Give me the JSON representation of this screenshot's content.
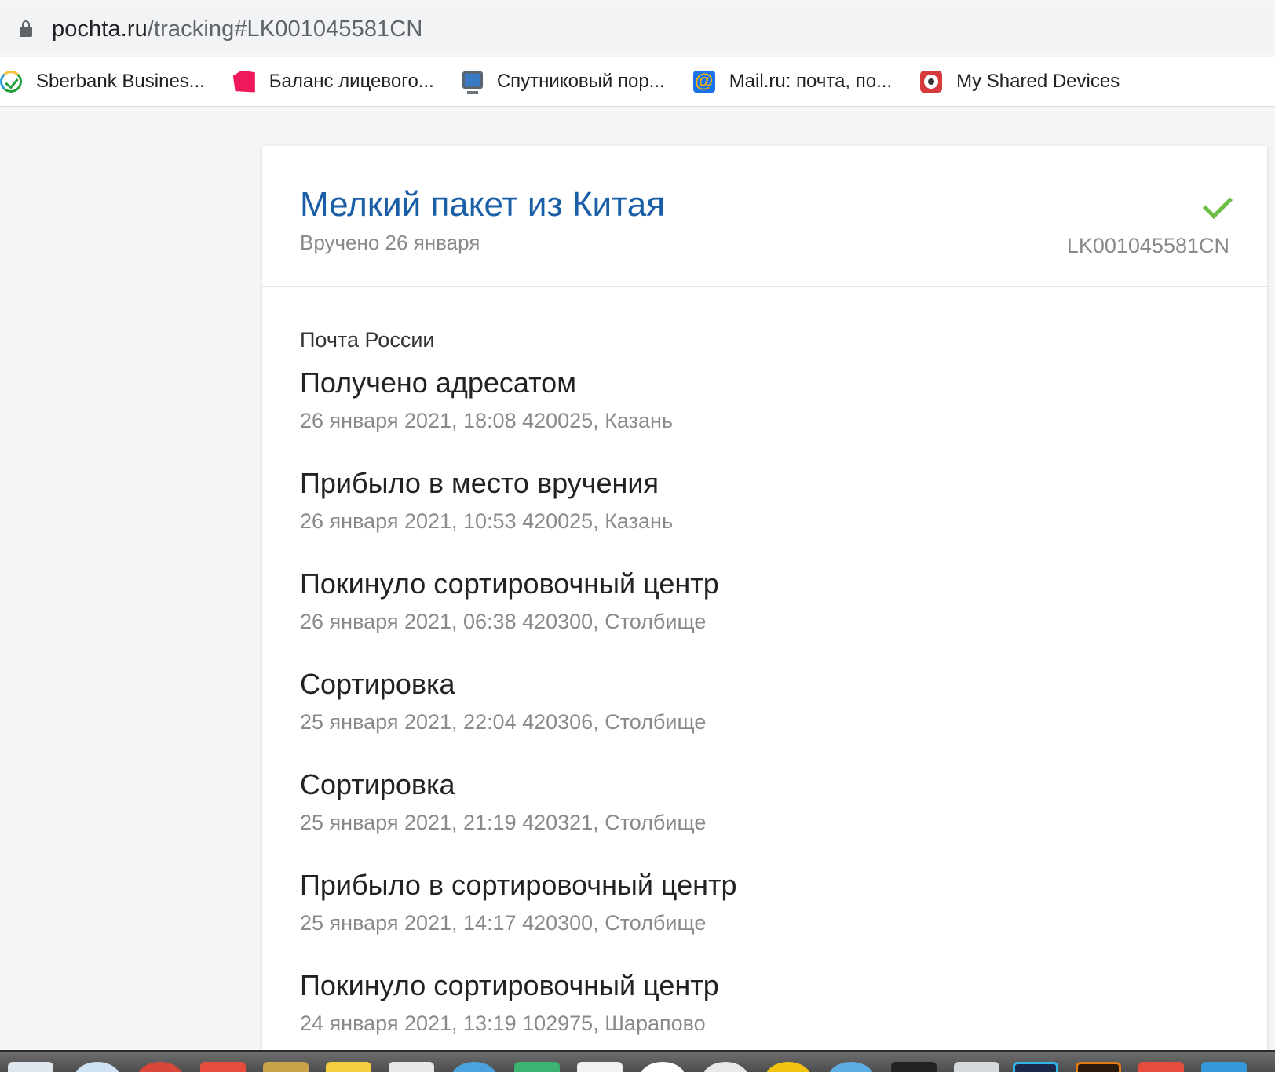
{
  "browser": {
    "url_domain": "pochta.ru",
    "url_path": "/tracking#LK001045581CN",
    "bookmarks": [
      {
        "label": "Sberbank Busines...",
        "icon": "sberbank-icon"
      },
      {
        "label": "Баланс лицевого...",
        "icon": "pink-shape-icon"
      },
      {
        "label": "Спутниковый пор...",
        "icon": "monitor-icon"
      },
      {
        "label": "Mail.ru: почта, по...",
        "icon": "mail-at-icon"
      },
      {
        "label": "My Shared Devices",
        "icon": "devices-icon"
      }
    ]
  },
  "parcel": {
    "title": "Мелкий пакет из Китая",
    "subtitle": "Вручено 26 января",
    "tracking_number": "LK001045581CN",
    "status_icon": "check-icon",
    "accent_color": "#1a5ea8",
    "check_color": "#6cbe45"
  },
  "history": {
    "carrier": "Почта России",
    "events": [
      {
        "status": "Получено адресатом",
        "meta": "26 января 2021, 18:08 420025, Казань"
      },
      {
        "status": "Прибыло в место вручения",
        "meta": "26 января 2021, 10:53 420025, Казань"
      },
      {
        "status": "Покинуло сортировочный центр",
        "meta": "26 января 2021, 06:38 420300, Столбище"
      },
      {
        "status": "Сортировка",
        "meta": "25 января 2021, 22:04 420306, Столбище"
      },
      {
        "status": "Сортировка",
        "meta": "25 января 2021, 21:19 420321, Столбище"
      },
      {
        "status": "Прибыло в сортировочный центр",
        "meta": "25 января 2021, 14:17 420300, Столбище"
      },
      {
        "status": "Покинуло сортировочный центр",
        "meta": "24 января 2021, 13:19 102975, Шарапово"
      }
    ]
  }
}
